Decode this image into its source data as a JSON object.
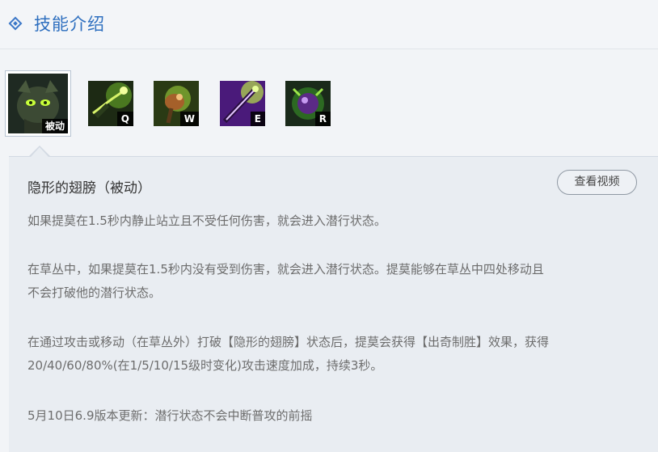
{
  "header": {
    "title": "技能介绍",
    "icon": "diamond-icon"
  },
  "skills": [
    {
      "key": "被动",
      "icon": "teemo-portrait-icon",
      "active": true
    },
    {
      "key": "Q",
      "icon": "blinding-dart-icon"
    },
    {
      "key": "W",
      "icon": "move-quick-icon"
    },
    {
      "key": "E",
      "icon": "toxic-shot-icon"
    },
    {
      "key": "R",
      "icon": "noxious-trap-icon"
    }
  ],
  "detail": {
    "name": "隐形的翅膀（被动）",
    "video_button": "查看视频",
    "paragraphs": [
      "如果提莫在1.5秒内静止站立且不受任何伤害，就会进入潜行状态。",
      "在草丛中，如果提莫在1.5秒内没有受到伤害，就会进入潜行状态。提莫能够在草丛中四处移动且",
      "不会打破他的潜行状态。",
      "在通过攻击或移动（在草丛外）打破【隐形的翅膀】状态后，提莫会获得【出奇制胜】效果，获得",
      "20/40/60/80%(在1/5/10/15级时变化)攻击速度加成，持续3秒。",
      "5月10日6.9版本更新：潜行状态不会中断普攻的前摇"
    ]
  },
  "colors": {
    "accent": "#2e6fbf",
    "panel_bg": "#e9edf2",
    "text": "#6d6d6d"
  }
}
